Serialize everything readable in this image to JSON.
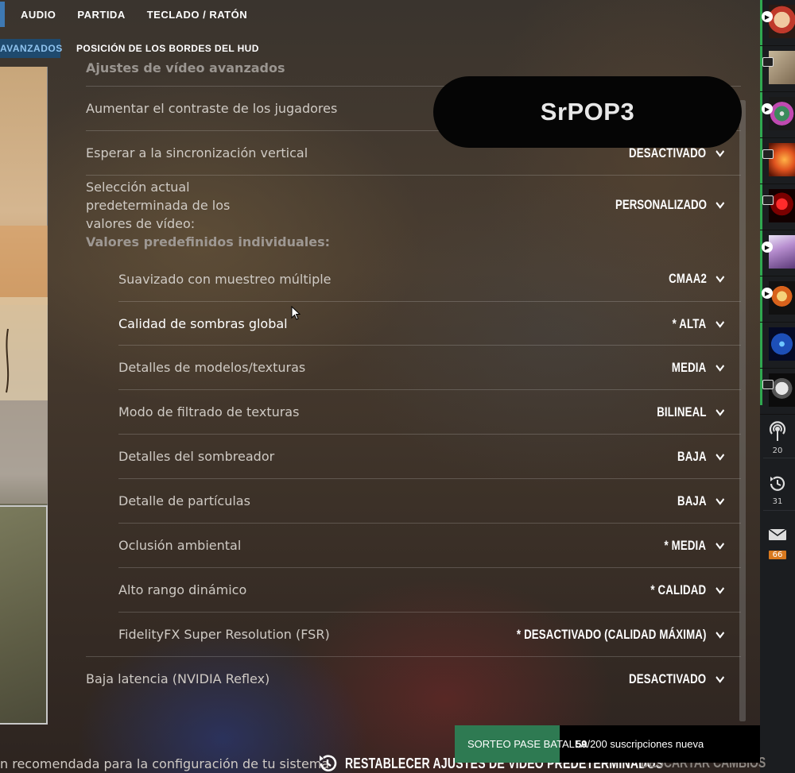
{
  "topnav": {
    "items": [
      "AUDIO",
      "PARTIDA",
      "TECLADO / RATÓN"
    ]
  },
  "subnav": {
    "active": "AVANZADOS",
    "item": "POSICIÓN DE LOS BORDES DEL HUD"
  },
  "section_title": "Ajustes de vídeo avanzados",
  "overlay_username": "SrPOP3",
  "settings": {
    "contrast": {
      "label": "Aumentar el contraste de los jugadores"
    },
    "vsync": {
      "label": "Esperar a la sincronización vertical",
      "value": "DESACTIVADO"
    },
    "preset": {
      "label_lines": [
        "Selección actual",
        "predeterminada de los",
        "valores de vídeo:"
      ],
      "value": "PERSONALIZADO",
      "sub_heading": "Valores predefinidos individuales:"
    },
    "msaa": {
      "label": "Suavizado con muestreo múltiple",
      "value": "CMAA2"
    },
    "shadows": {
      "label": "Calidad de sombras global",
      "value": "* ALTA"
    },
    "models": {
      "label": "Detalles de modelos/texturas",
      "value": "MEDIA"
    },
    "filtering": {
      "label": "Modo de filtrado de texturas",
      "value": "BILINEAL"
    },
    "shader": {
      "label": "Detalles del sombreador",
      "value": "BAJA"
    },
    "particles": {
      "label": "Detalle de partículas",
      "value": "BAJA"
    },
    "ao": {
      "label": "Oclusión ambiental",
      "value": "* MEDIA"
    },
    "hdr": {
      "label": "Alto rango dinámico",
      "value": "* CALIDAD"
    },
    "fsr": {
      "label": "FidelityFX Super Resolution (FSR)",
      "value": "* DESACTIVADO (CALIDAD MÁXIMA)"
    },
    "reflex": {
      "label": "Baja latencia (NVIDIA Reflex)",
      "value": "DESACTIVADO"
    }
  },
  "bottom": {
    "recommendation": "n recomendada para la configuración de tu sistema",
    "reset_label": "RESTABLECER AJUSTES DE VÍDEO PREDETERMINADOS",
    "discard_label": "DESCARTAR CAMBIOS"
  },
  "ticker": {
    "label": "SORTEO PASE BATALLA",
    "count": "59",
    "rest": "/200 suscripciones nueva"
  },
  "sidebar": {
    "stats": [
      {
        "icon": "podcast-icon",
        "value": "20"
      },
      {
        "icon": "history-icon",
        "value": "31"
      },
      {
        "icon": "mail-icon",
        "value": "66"
      }
    ]
  },
  "colors": {
    "accent_blue": "#3e79b3",
    "active_tab_bg": "#1f4a6e",
    "sidebar_green": "#2fa84f",
    "mail_badge": "#d9791e",
    "ticker_green": "#2e7a52"
  }
}
